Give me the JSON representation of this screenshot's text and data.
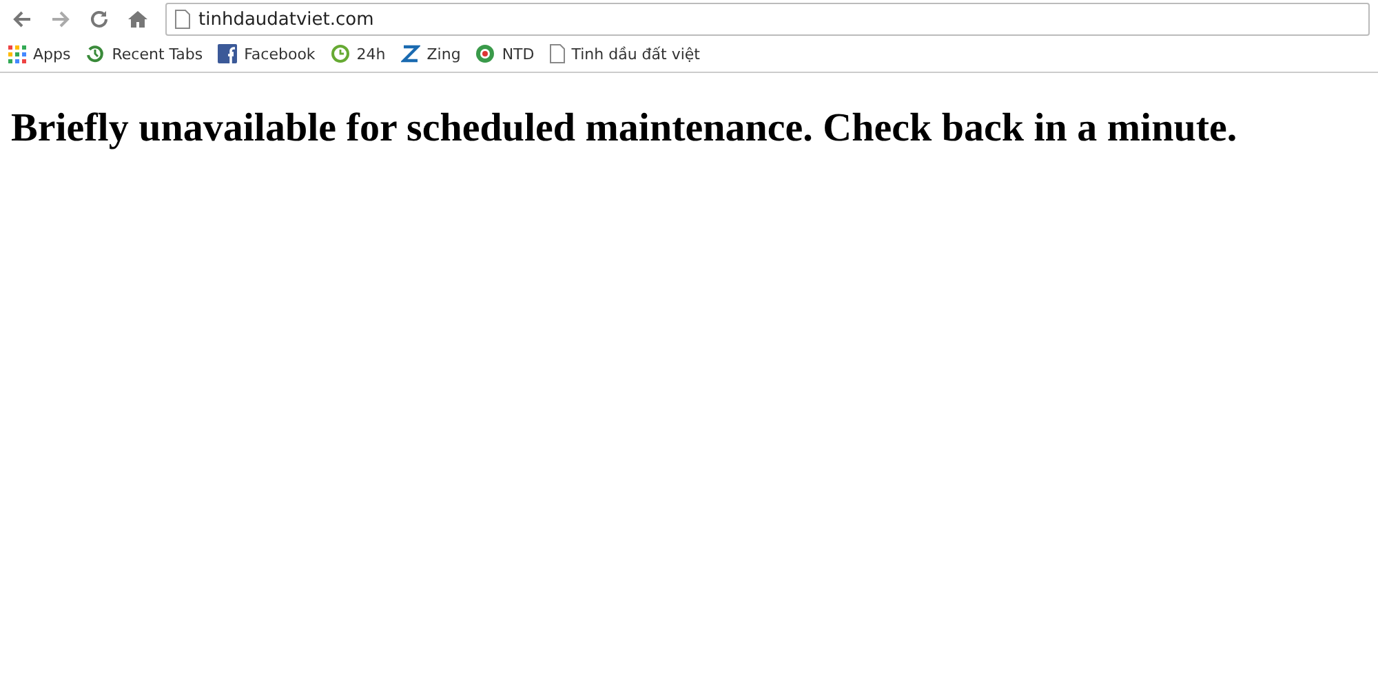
{
  "address_bar": {
    "url": "tinhdaudatviet.com"
  },
  "bookmarks": [
    {
      "kind": "apps",
      "label": "Apps"
    },
    {
      "kind": "history",
      "label": "Recent Tabs"
    },
    {
      "kind": "square",
      "label": "Facebook"
    },
    {
      "kind": "clock",
      "label": "24h"
    },
    {
      "kind": "zigzag",
      "label": "Zing"
    },
    {
      "kind": "globe",
      "label": "NTD"
    },
    {
      "kind": "page",
      "label": "Tinh dầu đất việt"
    }
  ],
  "page": {
    "heading": "Briefly unavailable for scheduled maintenance. Check back in a minute."
  }
}
